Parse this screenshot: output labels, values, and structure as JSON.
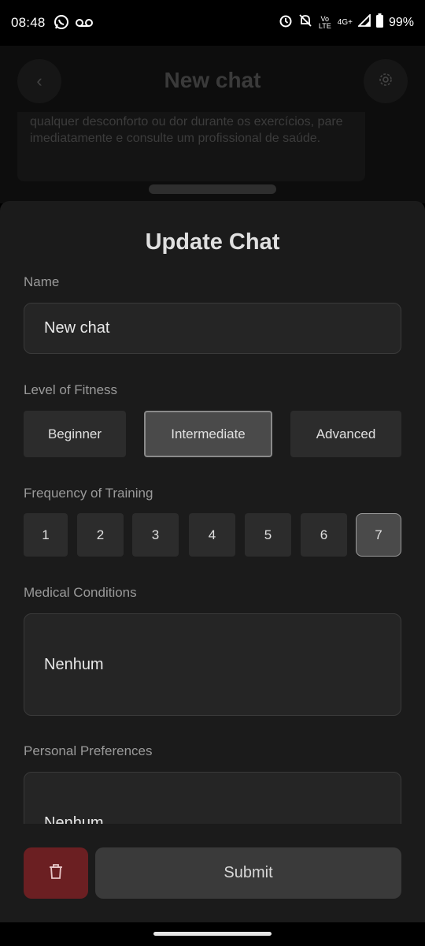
{
  "status": {
    "time": "08:48",
    "network": "4G+",
    "volte": "Vo LTE",
    "battery": "99%",
    "icons": [
      "whatsapp-icon",
      "voicemail-icon",
      "alarm-icon",
      "mute-icon",
      "signal-icon",
      "battery-icon"
    ]
  },
  "background_chat": {
    "title": "New chat",
    "message": "qualquer desconforto ou dor durante os exercícios, pare imediatamente e consulte um profissional de saúde."
  },
  "sheet": {
    "title": "Update Chat",
    "name_label": "Name",
    "name_value": "New chat",
    "fitness_label": "Level of Fitness",
    "fitness_options": [
      "Beginner",
      "Intermediate",
      "Advanced"
    ],
    "fitness_selected": "Intermediate",
    "frequency_label": "Frequency of Training",
    "frequency_options": [
      "1",
      "2",
      "3",
      "4",
      "5",
      "6",
      "7"
    ],
    "frequency_selected": "7",
    "medical_label": "Medical Conditions",
    "medical_value": "Nenhum",
    "preferences_label": "Personal Preferences",
    "preferences_value": "Nenhum",
    "submit_label": "Submit"
  },
  "colors": {
    "sheet_bg": "#1b1b1b",
    "delete_bg": "#6b1f22",
    "selected_bg": "#4a4a4a"
  }
}
